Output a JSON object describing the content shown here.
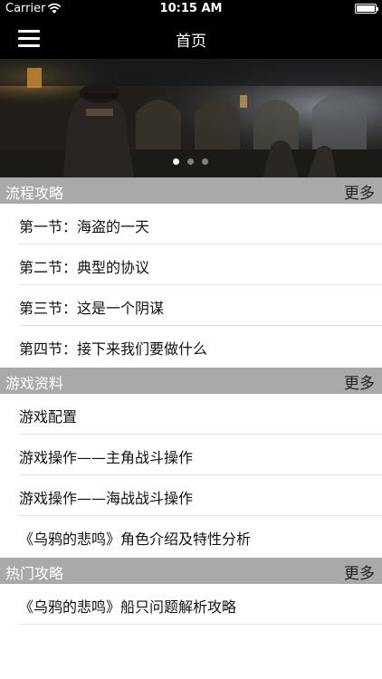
{
  "status_bar": {
    "carrier": "Carrier",
    "time": "10:15 AM"
  },
  "nav": {
    "title": "首页",
    "menu_icon": "hamburger-menu-icon"
  },
  "banner": {
    "page_count": 3,
    "active_page": 1
  },
  "sections": [
    {
      "title": "流程攻略",
      "more_label": "更多",
      "items": [
        "第一节：海盗的一天",
        "第二节：典型的协议",
        "第三节：这是一个阴谋",
        "第四节：接下来我们要做什么"
      ]
    },
    {
      "title": "游戏资料",
      "more_label": "更多",
      "items": [
        "游戏配置",
        "游戏操作——主角战斗操作",
        "游戏操作——海战战斗操作",
        "《乌鸦的悲鸣》角色介绍及特性分析"
      ]
    },
    {
      "title": "热门攻略",
      "more_label": "更多",
      "items": [
        "《乌鸦的悲鸣》船只问题解析攻略"
      ]
    }
  ],
  "colors": {
    "bar_bg": "#000000",
    "section_bg": "#a9a9a9",
    "separator": "#e2e2e2"
  }
}
